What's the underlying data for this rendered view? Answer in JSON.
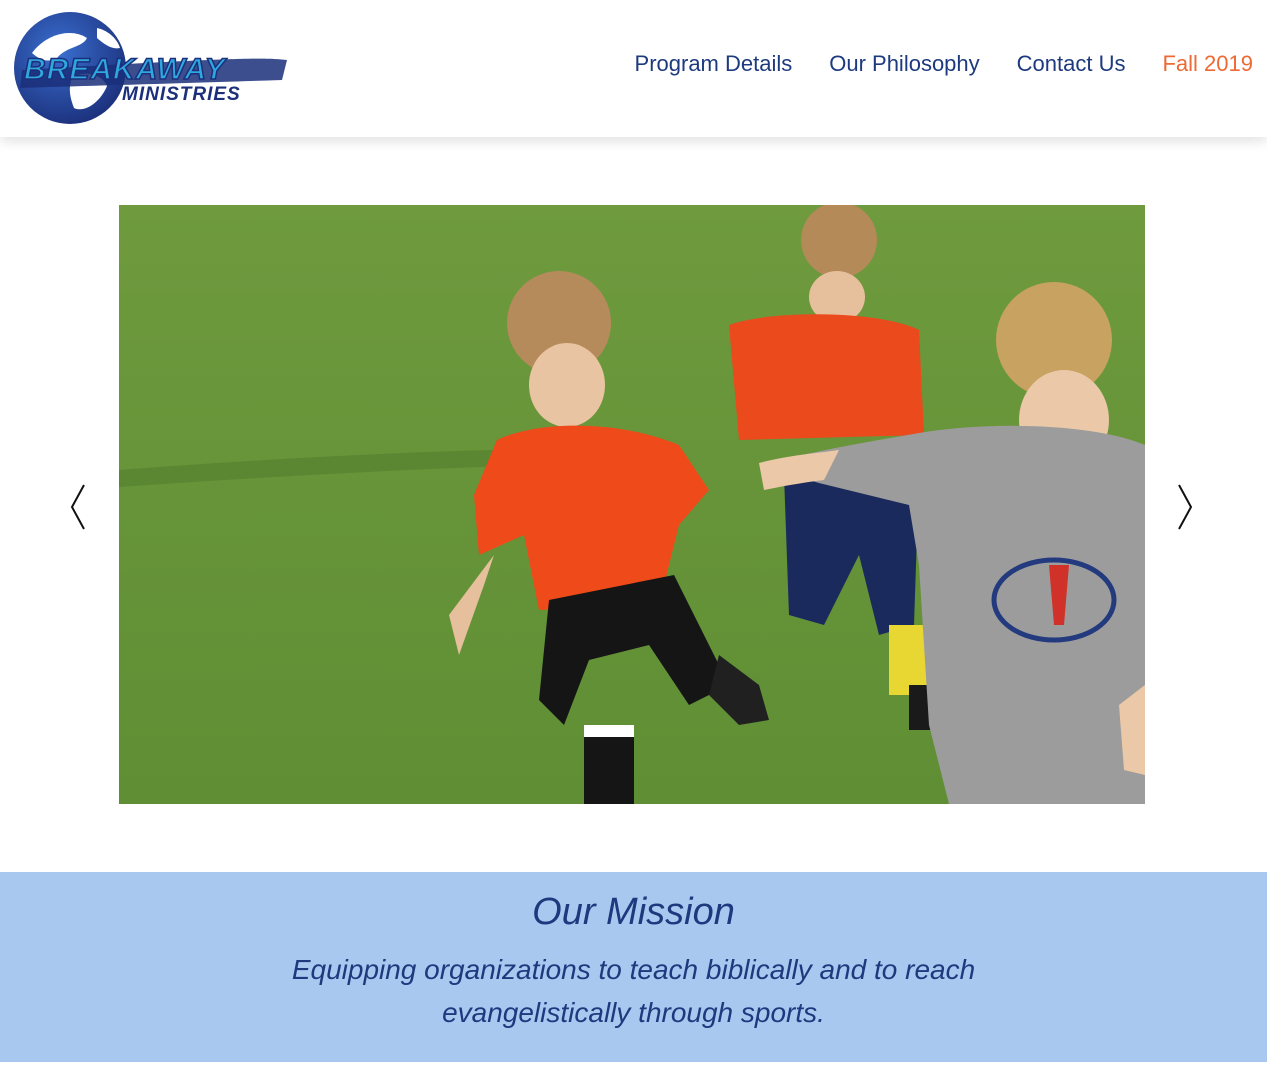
{
  "brand": {
    "logo_text": "BREAKAWAY",
    "logo_subtext": "MINISTRIES"
  },
  "nav": {
    "items": [
      {
        "label": "Program Details"
      },
      {
        "label": "Our Philosophy"
      },
      {
        "label": "Contact Us"
      },
      {
        "label": "Fall 2019"
      }
    ],
    "active_index": 3,
    "link_color": "#1d3a7e",
    "active_color": "#ee6a34"
  },
  "slider": {
    "prev_icon": "chevron-left-icon",
    "next_icon": "chevron-right-icon"
  },
  "mission": {
    "title": "Our Mission",
    "text": "Equipping organizations to teach biblically and to reach evangelistically through sports.",
    "background": "#a8c8f0"
  }
}
